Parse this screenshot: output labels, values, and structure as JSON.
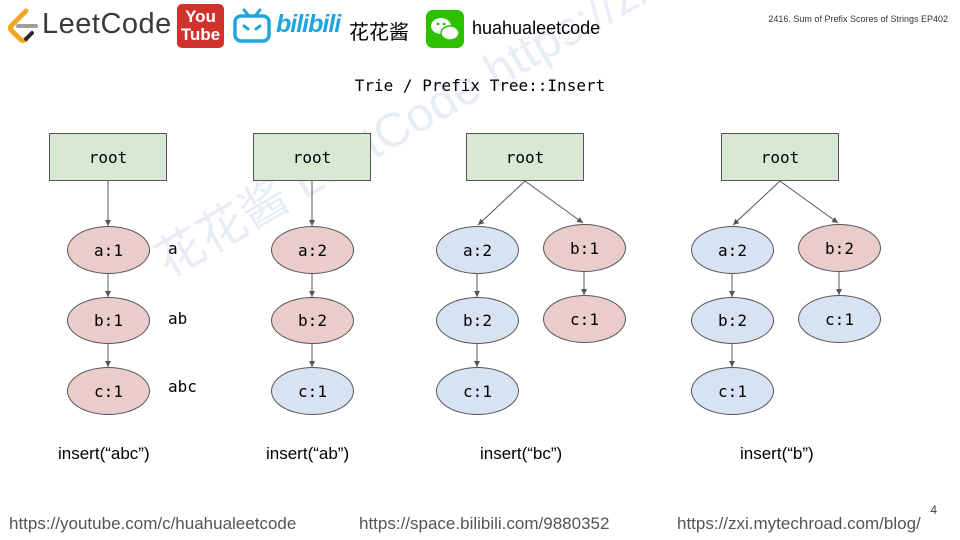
{
  "header": {
    "leetcode": "LeetCode",
    "youtube_l1": "You",
    "youtube_l2": "Tube",
    "bilibili": "bilibili",
    "chinese_name": "花花酱",
    "wechat_id": "huahualeetcode",
    "episode": "2416. Sum of Prefix Scores of Strings EP402"
  },
  "slide": {
    "title": "Trie / Prefix Tree::Insert",
    "watermark": "花花酱 LeetCode https://zxi.mytechroad.com/blog/",
    "page_number": "4"
  },
  "diagrams": {
    "d1": {
      "root": "root",
      "n1": "a:1",
      "n2": "b:1",
      "n3": "c:1",
      "p1": "a",
      "p2": "ab",
      "p3": "abc",
      "caption": "insert(“abc”)"
    },
    "d2": {
      "root": "root",
      "n1": "a:2",
      "n2": "b:2",
      "n3": "c:1",
      "caption": "insert(“ab”)"
    },
    "d3": {
      "root": "root",
      "n1": "a:2",
      "n2": "b:2",
      "n3": "c:1",
      "m1": "b:1",
      "m2": "c:1",
      "caption": "insert(“bc”)"
    },
    "d4": {
      "root": "root",
      "n1": "a:2",
      "n2": "b:2",
      "n3": "c:1",
      "m1": "b:2",
      "m2": "c:1",
      "caption": "insert(“b”)"
    }
  },
  "footer": {
    "youtube": "https://youtube.com/c/huahualeetcode",
    "bilibili": "https://space.bilibili.com/9880352",
    "blog": "https://zxi.mytechroad.com/blog/"
  },
  "colors": {
    "root_fill": "#d9e8d3",
    "highlight_node": "#ebcccc",
    "normal_node": "#d7e3f2"
  }
}
